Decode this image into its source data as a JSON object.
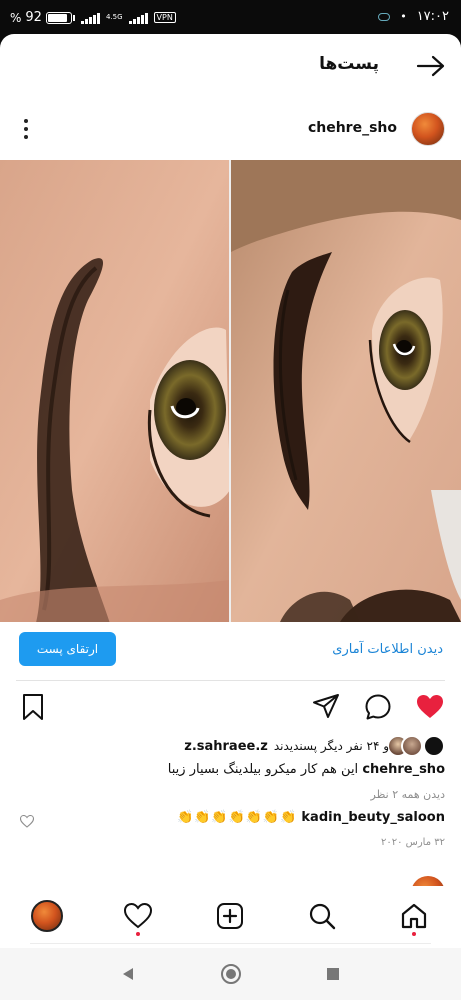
{
  "status_bar": {
    "battery": "92",
    "battery_level": 0.92,
    "network": "4.5G",
    "vpn": "VPN",
    "time": "۱۷:۰۲"
  },
  "header": {
    "title": "پست‌ها",
    "back_icon": "arrow-right-icon"
  },
  "post": {
    "username": "chehre_sho",
    "more_icon": "more-vertical-icon",
    "insights_label": "دیدن اطلاعات آماری",
    "boost_label": "ارتقای پست",
    "likes": {
      "first_user": "z.sahraee.z",
      "others_text": "و ۲۴ نفر دیگر پسندیدند"
    },
    "caption": {
      "user": "chehre_sho",
      "text": "این هم کار میکرو بیلدینگ  بسیار زیبا"
    },
    "view_comments": "دیدن همه ۲ نظر",
    "comment": {
      "user": "kadin_beuty_saloon",
      "text": "👏👏👏👏👏👏👏"
    },
    "date": "۳۲ مارس ۲۰۲۰"
  },
  "colors": {
    "accent": "#1e9bf0",
    "like": "#e8213e",
    "link": "#1a84d6",
    "muted": "#8e8e8e"
  },
  "bottom_nav": [
    "profile-tab",
    "activity-tab",
    "create-tab",
    "search-tab",
    "home-tab"
  ]
}
